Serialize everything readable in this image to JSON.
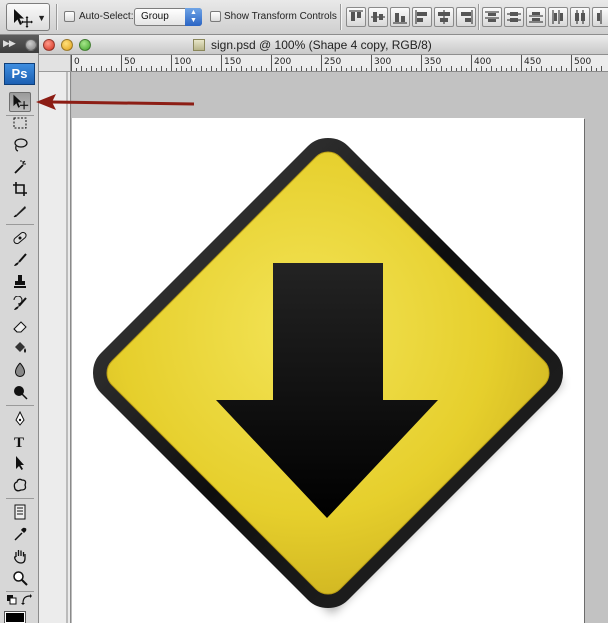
{
  "options_bar": {
    "auto_select_label": "Auto-Select:",
    "auto_select_value": "Group",
    "show_transform_label": "Show Transform Controls"
  },
  "document": {
    "title": "sign.psd @ 100% (Shape 4 copy, RGB/8)"
  },
  "app": {
    "logo": "Ps"
  },
  "ruler": {
    "h_labels": [
      "0",
      "50",
      "100",
      "150",
      "200",
      "250",
      "300",
      "350",
      "400",
      "450",
      "500"
    ]
  },
  "tools": [
    {
      "name": "move-tool",
      "icon": "move-icon",
      "active": true
    },
    {
      "name": "marquee-tool",
      "icon": "marquee-icon"
    },
    {
      "name": "lasso-tool",
      "icon": "lasso-icon"
    },
    {
      "name": "magic-wand-tool",
      "icon": "magic-wand-icon"
    },
    {
      "name": "crop-tool",
      "icon": "crop-icon"
    },
    {
      "name": "slice-tool",
      "icon": "slice-icon"
    },
    {
      "name": "healing-brush-tool",
      "icon": "bandage-icon"
    },
    {
      "name": "brush-tool",
      "icon": "brush-icon"
    },
    {
      "name": "clone-stamp-tool",
      "icon": "stamp-icon"
    },
    {
      "name": "history-brush-tool",
      "icon": "history-brush-icon"
    },
    {
      "name": "eraser-tool",
      "icon": "eraser-icon"
    },
    {
      "name": "paint-bucket-tool",
      "icon": "bucket-icon"
    },
    {
      "name": "blur-tool",
      "icon": "blur-icon"
    },
    {
      "name": "dodge-tool",
      "icon": "dodge-icon"
    },
    {
      "name": "pen-tool",
      "icon": "pen-icon"
    },
    {
      "name": "type-tool",
      "icon": "type-icon"
    },
    {
      "name": "path-selection-tool",
      "icon": "path-select-icon"
    },
    {
      "name": "custom-shape-tool",
      "icon": "shape-icon"
    },
    {
      "name": "notes-tool",
      "icon": "notes-icon"
    },
    {
      "name": "eyedropper-tool",
      "icon": "eyedropper-icon"
    },
    {
      "name": "hand-tool",
      "icon": "hand-icon"
    },
    {
      "name": "zoom-tool",
      "icon": "zoom-icon"
    }
  ],
  "colors": {
    "sign_yellow": "#efdc3a",
    "sign_border": "#151515",
    "callout_arrow": "#8c1d14"
  }
}
